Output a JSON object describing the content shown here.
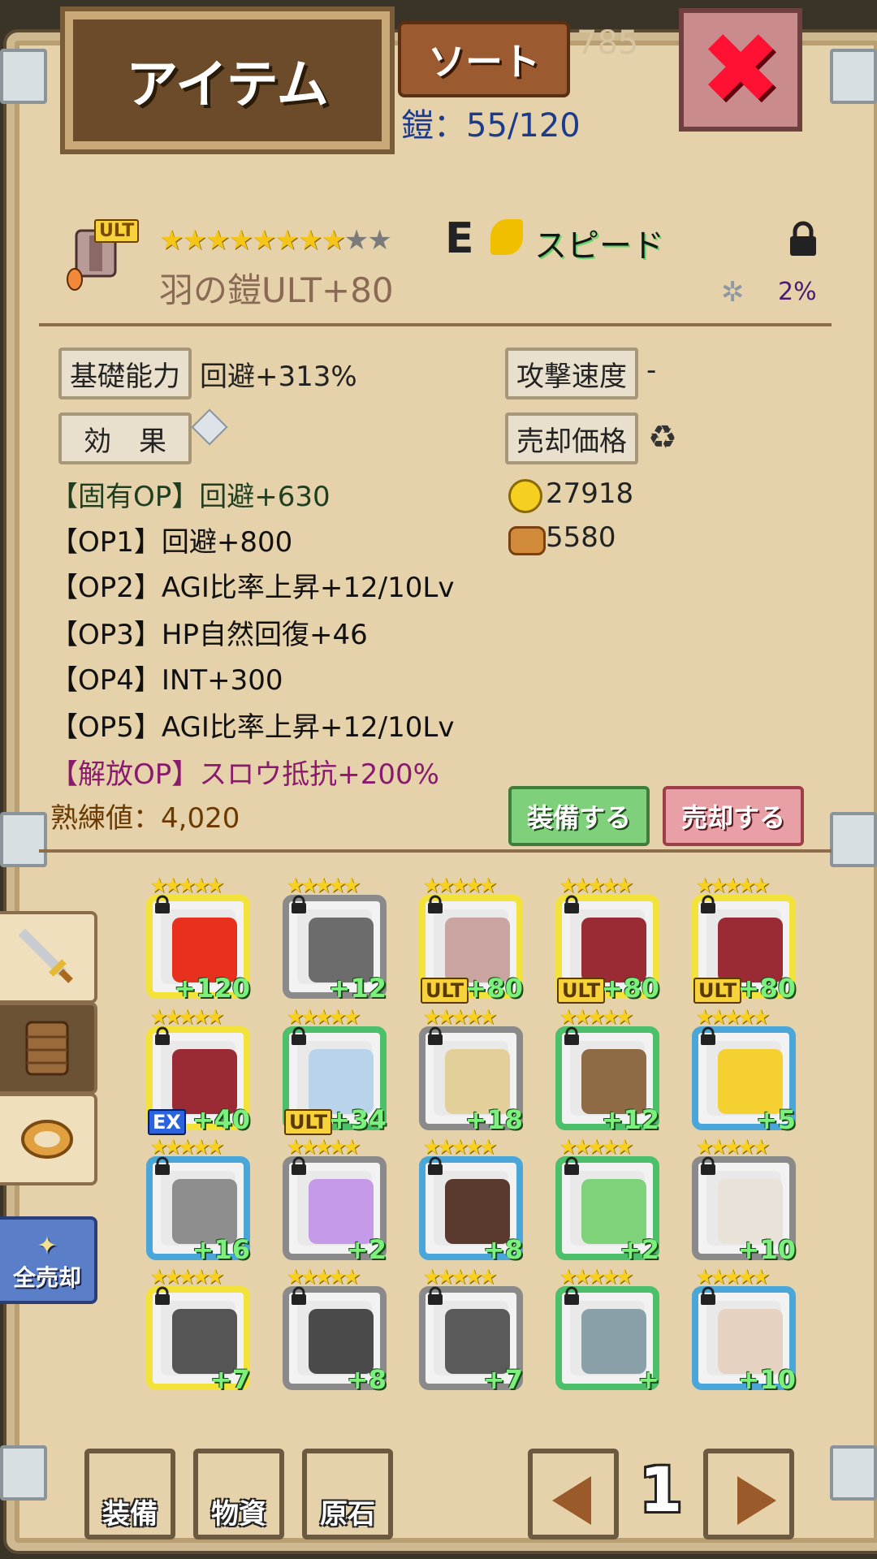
{
  "header": {
    "title": "アイテム",
    "sort_label": "ソート",
    "capacity": "鎧：55/120",
    "faint_bg_number": "785"
  },
  "item": {
    "badge": "ULT",
    "stars_filled": 8,
    "stars_total": 10,
    "rank": "E",
    "type": "スピード",
    "name": "羽の鎧ULT+80",
    "gear_percent": "2%",
    "base_label": "基礎能力",
    "base_value": "回避+313%",
    "attack_speed_label": "攻撃速度",
    "attack_speed_value": "-",
    "effect_label": "効　果",
    "sell_price_label": "売却価格",
    "sell_gold": "27918",
    "sell_material": "5580",
    "options": [
      "【固有OP】回避+630",
      "【OP1】回避+800",
      "【OP2】AGI比率上昇+12/10Lv",
      "【OP3】HP自然回復+46",
      "【OP4】INT+300",
      "【OP5】AGI比率上昇+12/10Lv",
      "【解放OP】スロウ抵抗+200%"
    ],
    "mastery": "熟練値：4,020",
    "equip_label": "装備する",
    "sell_label": "売却する"
  },
  "side": {
    "sell_all_label": "全売却"
  },
  "grid": [
    {
      "plus": "+120",
      "badge": "",
      "border": "#f3e23a",
      "color": "#e8301f"
    },
    {
      "plus": "+12",
      "badge": "",
      "border": "#8a8a8a",
      "color": "#6c6c6c"
    },
    {
      "plus": "+80",
      "badge": "ULT",
      "border": "#f3e23a",
      "color": "#c9a4a0"
    },
    {
      "plus": "+80",
      "badge": "ULT",
      "border": "#f3e23a",
      "color": "#9a2a33"
    },
    {
      "plus": "+80",
      "badge": "ULT",
      "border": "#f3e23a",
      "color": "#9a2a33"
    },
    {
      "plus": "+40",
      "badge": "EX",
      "border": "#f3e23a",
      "color": "#9a2a33"
    },
    {
      "plus": "+34",
      "badge": "ULT",
      "border": "#4cbf6a",
      "color": "#b9d3ea"
    },
    {
      "plus": "+18",
      "badge": "",
      "border": "#8a8a8a",
      "color": "#e2cf9a"
    },
    {
      "plus": "+12",
      "badge": "",
      "border": "#4cbf6a",
      "color": "#8e6a45"
    },
    {
      "plus": "+5",
      "badge": "",
      "border": "#4aa6d8",
      "color": "#f4d030"
    },
    {
      "plus": "+16",
      "badge": "",
      "border": "#4aa6d8",
      "color": "#8e8e8e"
    },
    {
      "plus": "+2",
      "badge": "",
      "border": "#8a8a8a",
      "color": "#c59ae8"
    },
    {
      "plus": "+8",
      "badge": "",
      "border": "#4aa6d8",
      "color": "#5a3a2e"
    },
    {
      "plus": "+2",
      "badge": "",
      "border": "#4cbf6a",
      "color": "#7ed37a"
    },
    {
      "plus": "+10",
      "badge": "",
      "border": "#8a8a8a",
      "color": "#e8e2d8"
    },
    {
      "plus": "+7",
      "badge": "",
      "border": "#f3e23a",
      "color": "#555555"
    },
    {
      "plus": "+8",
      "badge": "",
      "border": "#8a8a8a",
      "color": "#4a4a4a"
    },
    {
      "plus": "+7",
      "badge": "",
      "border": "#8a8a8a",
      "color": "#5a5a5a"
    },
    {
      "plus": "+",
      "badge": "",
      "border": "#4cbf6a",
      "color": "#8aa0a8"
    },
    {
      "plus": "+10",
      "badge": "",
      "border": "#4aa6d8",
      "color": "#e6d2c0"
    }
  ],
  "bottom": {
    "equip_tab": "装備",
    "material_tab": "物資",
    "ore_tab": "原石",
    "page": "1"
  }
}
